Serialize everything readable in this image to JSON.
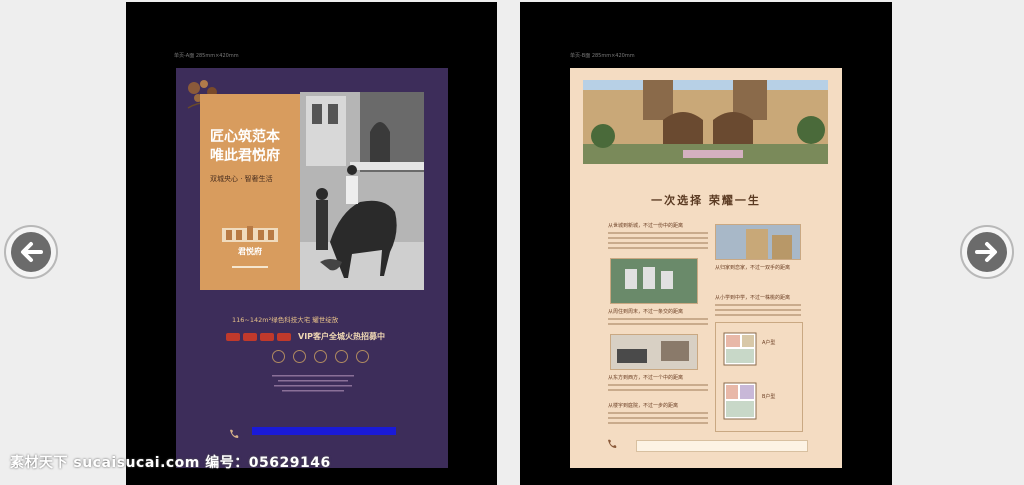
{
  "left_page": {
    "caption": "单页-A面  285mm×420mm",
    "headline_1": "匠心筑范本",
    "headline_2": "唯此君悦府",
    "subline": "双城央心 · 智奢生活",
    "logo_name": "君悦府",
    "area_line": "116~142m²绿色科技大宅  耀世绽放",
    "vip_line": "VIP客户全城火热招募中",
    "brand_color": "#3d2d5a",
    "accent_color": "#d89c5e"
  },
  "right_page": {
    "caption": "单页-B面  285mm×420mm",
    "title": "一次选择 荣耀一生",
    "sections": [
      "从世城到新城，不过一份中的距离",
      "从归家到恋家，不过一双手的距离",
      "从周住到周末，不过一条交的距离",
      "从小学到中学，不过一株桃的距离",
      "从东方到西方，不过一个中的距离",
      "从楼宇到庭院，不过一步的距离"
    ],
    "plan_labels": [
      "A户型",
      "B户型"
    ],
    "background_color": "#f4dcc2"
  },
  "navigation": {
    "prev_icon": "left-arrow-icon",
    "next_icon": "right-arrow-icon"
  },
  "watermark": {
    "text": "素材天下 sucaisucai.com  编号：05629146"
  }
}
